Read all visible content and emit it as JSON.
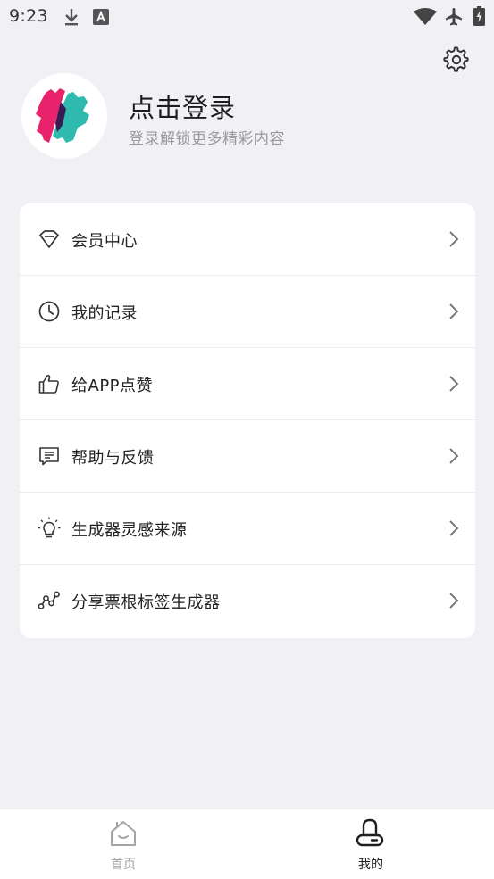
{
  "status_bar": {
    "time": "9:23"
  },
  "profile": {
    "title": "点击登录",
    "subtitle": "登录解锁更多精彩内容"
  },
  "menu": {
    "items": [
      {
        "label": "会员中心",
        "icon": "diamond-icon"
      },
      {
        "label": "我的记录",
        "icon": "clock-icon"
      },
      {
        "label": "给APP点赞",
        "icon": "thumbs-up-icon"
      },
      {
        "label": "帮助与反馈",
        "icon": "message-icon"
      },
      {
        "label": "生成器灵感来源",
        "icon": "lightbulb-icon"
      },
      {
        "label": "分享票根标签生成器",
        "icon": "share-nodes-icon"
      }
    ]
  },
  "tabbar": {
    "tabs": [
      {
        "label": "首页",
        "icon": "home-icon",
        "active": false
      },
      {
        "label": "我的",
        "icon": "profile-icon",
        "active": true
      }
    ]
  },
  "colors": {
    "background": "#f1f0f5",
    "card": "#ffffff",
    "logo_pink": "#e8236b",
    "logo_teal": "#2fbab0",
    "tab_active": "#1f1f1f",
    "tab_inactive": "#a5a5a5"
  }
}
